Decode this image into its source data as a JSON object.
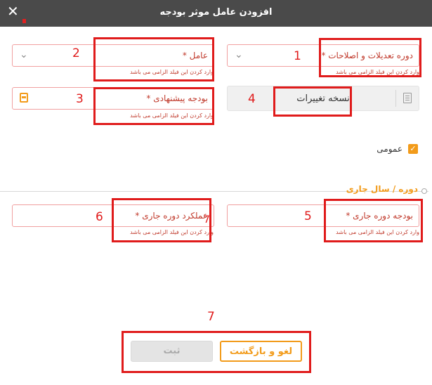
{
  "dialog": {
    "title": "افزودن عامل موثر بودجه",
    "close_glyph": "✕"
  },
  "fields": {
    "adjustment_period": {
      "label": "دوره تعدیلات و اصلاحات *",
      "hint": "وارد کردن این فیلد الزامی می باشد",
      "icon": "chevron-down-icon"
    },
    "factor": {
      "label": "عامل *",
      "hint": "وارد کردن این فیلد الزامی می باشد",
      "icon": "chevron-down-icon"
    },
    "proposed_budget": {
      "label": "بودجه پیشنهادی *",
      "hint": "وارد کردن این فیلد الزامی می باشد",
      "icon": "calculator-icon"
    },
    "version": {
      "label": "نسخه تغییرات",
      "icon": "document-icon"
    },
    "current_budget": {
      "label": "بودجه دوره جاری *",
      "hint": "وارد کردن این فیلد الزامی می باشد"
    },
    "current_performance": {
      "label": "عملکرد دوره جاری *",
      "hint": "وارد کردن این فیلد الزامی می باشد"
    }
  },
  "general_checkbox": {
    "label": "عمومی",
    "checked": true
  },
  "section": {
    "title": "دوره / سال جاری"
  },
  "buttons": {
    "cancel": "لغو و بازگشت",
    "submit": "ثبت"
  },
  "annotations": [
    "1",
    "2",
    "3",
    "4",
    "5",
    "6",
    "7",
    "7"
  ],
  "colors": {
    "accent": "#f29b1a",
    "error": "#c0392b",
    "annotation": "#e01b1b",
    "titlebar": "#4a4a4a"
  }
}
